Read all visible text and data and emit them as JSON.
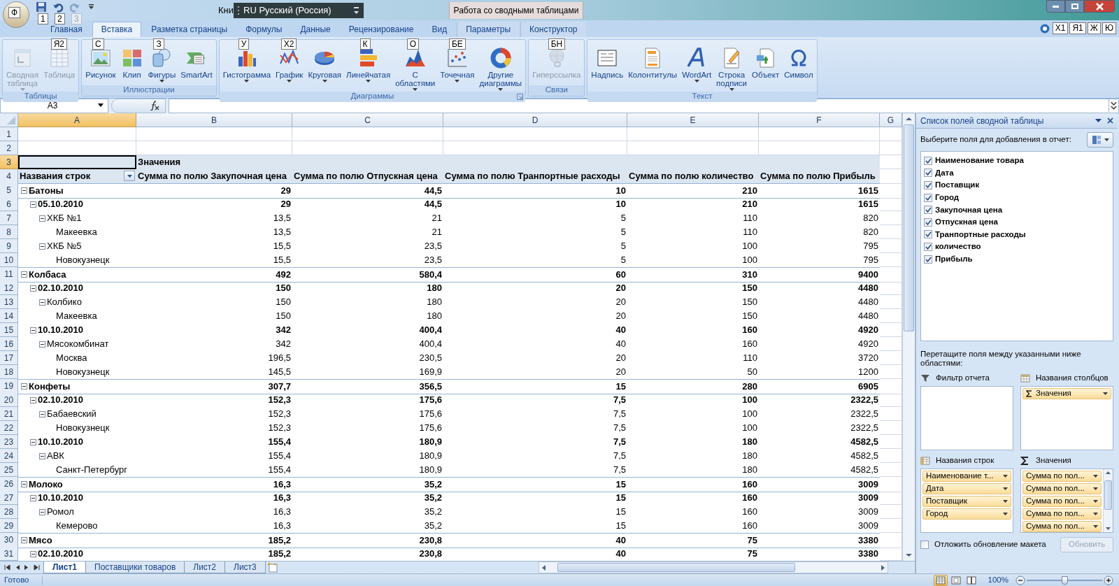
{
  "title_bar": {
    "office_keytip": "Ф",
    "quick_access": [
      {
        "keytip": "1",
        "disabled": false
      },
      {
        "keytip": "2",
        "disabled": false
      },
      {
        "keytip": "3",
        "disabled": true
      }
    ],
    "title": "Кни",
    "language_bar": "RU Русский (Россия)",
    "context_title": "Работа со сводными таблицами"
  },
  "tabs": [
    {
      "label": "Главная",
      "selected": false,
      "contextual": false
    },
    {
      "label": "Вставка",
      "selected": true,
      "contextual": false
    },
    {
      "label": "Разметка страницы",
      "selected": false,
      "contextual": false
    },
    {
      "label": "Формулы",
      "selected": false,
      "contextual": false
    },
    {
      "label": "Данные",
      "selected": false,
      "contextual": false
    },
    {
      "label": "Рецензирование",
      "selected": false,
      "contextual": false
    },
    {
      "label": "Вид",
      "selected": false,
      "contextual": false
    },
    {
      "label": "Параметры",
      "selected": false,
      "contextual": true
    },
    {
      "label": "Конструктор",
      "selected": false,
      "contextual": true
    }
  ],
  "window_keytips": [
    "Х1",
    "Я1",
    "Ж",
    "Ю"
  ],
  "ribbon_groups": [
    {
      "label": "Таблицы",
      "launcher": false,
      "buttons": [
        {
          "label": "Сводная\nтаблица",
          "disabled": true,
          "dropdown": true
        },
        {
          "label": "Таблица",
          "disabled": true,
          "dropdown": false,
          "keytip": "Я2"
        }
      ]
    },
    {
      "label": "Иллюстрации",
      "launcher": false,
      "buttons": [
        {
          "label": "Рисунок",
          "disabled": false,
          "dropdown": false,
          "keytip": "С"
        },
        {
          "label": "Клип",
          "disabled": false,
          "dropdown": false
        },
        {
          "label": "Фигуры",
          "disabled": false,
          "dropdown": true,
          "keytip": "З"
        },
        {
          "label": "SmartArt",
          "disabled": false,
          "dropdown": false
        }
      ]
    },
    {
      "label": "Диаграммы",
      "launcher": true,
      "buttons": [
        {
          "label": "Гистограмма",
          "disabled": false,
          "dropdown": true,
          "keytip": "У"
        },
        {
          "label": "График",
          "disabled": false,
          "dropdown": true,
          "keytip": "Х2"
        },
        {
          "label": "Круговая",
          "disabled": false,
          "dropdown": true
        },
        {
          "label": "Линейчатая",
          "disabled": false,
          "dropdown": true,
          "keytip": "К"
        },
        {
          "label": "С\nобластями",
          "disabled": false,
          "dropdown": true,
          "keytip": "О"
        },
        {
          "label": "Точечная",
          "disabled": false,
          "dropdown": true,
          "keytip": "БЕ"
        },
        {
          "label": "Другие\nдиаграммы",
          "disabled": false,
          "dropdown": true
        }
      ]
    },
    {
      "label": "Связи",
      "launcher": false,
      "buttons": [
        {
          "label": "Гиперссылка",
          "disabled": true,
          "dropdown": false,
          "keytip": "БН"
        }
      ]
    },
    {
      "label": "Текст",
      "launcher": false,
      "buttons": [
        {
          "label": "Надпись",
          "disabled": false,
          "dropdown": false
        },
        {
          "label": "Колонтитулы",
          "disabled": false,
          "dropdown": false
        },
        {
          "label": "WordArt",
          "disabled": false,
          "dropdown": true
        },
        {
          "label": "Строка\nподписи",
          "disabled": false,
          "dropdown": true
        },
        {
          "label": "Объект",
          "disabled": false,
          "dropdown": false
        },
        {
          "label": "Символ",
          "disabled": false,
          "dropdown": false
        }
      ]
    }
  ],
  "formula_bar": {
    "name_box": "A3"
  },
  "sheet": {
    "columns": [
      {
        "label": "A",
        "selected": true
      },
      {
        "label": "B",
        "selected": false
      },
      {
        "label": "C",
        "selected": false
      },
      {
        "label": "D",
        "selected": false
      },
      {
        "label": "E",
        "selected": false
      },
      {
        "label": "F",
        "selected": false
      },
      {
        "label": "G",
        "selected": false
      }
    ],
    "blank_rows": [
      {
        "number": "1",
        "selected": false
      },
      {
        "number": "2",
        "selected": false
      }
    ],
    "pivot": {
      "title_row": {
        "number": "3",
        "selected": true,
        "title": "Значения"
      },
      "header_row": {
        "number": "4",
        "selected": false,
        "row_label": "Названия строк",
        "headings": [
          "Сумма по полю Закупочная цена",
          "Сумма по полю Отпускная цена",
          "Сумма по полю Транпортные расходы",
          "Сумма по полю количество",
          "Сумма по полю Прибыль"
        ]
      },
      "items": [
        {
          "number": "5",
          "label": "Батоны",
          "values": [
            "29",
            "44,5",
            "10",
            "210",
            "1615"
          ],
          "expanded": true,
          "children": [
            {
              "number": "6",
              "label": "05.10.2010",
              "values": [
                "29",
                "44,5",
                "10",
                "210",
                "1615"
              ],
              "expanded": true,
              "children": [
                {
                  "number": "7",
                  "label": "ХКБ №1",
                  "values": [
                    "13,5",
                    "21",
                    "5",
                    "110",
                    "820"
                  ],
                  "expanded": true,
                  "children": [
                    {
                      "number": "8",
                      "label": "Макеевка",
                      "values": [
                        "13,5",
                        "21",
                        "5",
                        "110",
                        "820"
                      ]
                    }
                  ]
                },
                {
                  "number": "9",
                  "label": "ХКБ №5",
                  "values": [
                    "15,5",
                    "23,5",
                    "5",
                    "100",
                    "795"
                  ],
                  "expanded": true,
                  "children": [
                    {
                      "number": "10",
                      "label": "Новокузнецк",
                      "values": [
                        "15,5",
                        "23,5",
                        "5",
                        "100",
                        "795"
                      ]
                    }
                  ]
                }
              ]
            }
          ]
        },
        {
          "number": "11",
          "label": "Колбаса",
          "values": [
            "492",
            "580,4",
            "60",
            "310",
            "9400"
          ],
          "expanded": true,
          "children": [
            {
              "number": "12",
              "label": "02.10.2010",
              "values": [
                "150",
                "180",
                "20",
                "150",
                "4480"
              ],
              "expanded": true,
              "children": [
                {
                  "number": "13",
                  "label": "Колбико",
                  "values": [
                    "150",
                    "180",
                    "20",
                    "150",
                    "4480"
                  ],
                  "expanded": true,
                  "children": [
                    {
                      "number": "14",
                      "label": "Макеевка",
                      "values": [
                        "150",
                        "180",
                        "20",
                        "150",
                        "4480"
                      ]
                    }
                  ]
                }
              ]
            },
            {
              "number": "15",
              "label": "10.10.2010",
              "values": [
                "342",
                "400,4",
                "40",
                "160",
                "4920"
              ],
              "expanded": true,
              "children": [
                {
                  "number": "16",
                  "label": "Мясокомбинат",
                  "values": [
                    "342",
                    "400,4",
                    "40",
                    "160",
                    "4920"
                  ],
                  "expanded": true,
                  "children": [
                    {
                      "number": "17",
                      "label": "Москва",
                      "values": [
                        "196,5",
                        "230,5",
                        "20",
                        "110",
                        "3720"
                      ]
                    },
                    {
                      "number": "18",
                      "label": "Новокузнецк",
                      "values": [
                        "145,5",
                        "169,9",
                        "20",
                        "50",
                        "1200"
                      ]
                    }
                  ]
                }
              ]
            }
          ]
        },
        {
          "number": "19",
          "label": "Конфеты",
          "values": [
            "307,7",
            "356,5",
            "15",
            "280",
            "6905"
          ],
          "expanded": true,
          "children": [
            {
              "number": "20",
              "label": "02.10.2010",
              "values": [
                "152,3",
                "175,6",
                "7,5",
                "100",
                "2322,5"
              ],
              "expanded": true,
              "children": [
                {
                  "number": "21",
                  "label": "Бабаевский",
                  "values": [
                    "152,3",
                    "175,6",
                    "7,5",
                    "100",
                    "2322,5"
                  ],
                  "expanded": true,
                  "children": [
                    {
                      "number": "22",
                      "label": "Новокузнецк",
                      "values": [
                        "152,3",
                        "175,6",
                        "7,5",
                        "100",
                        "2322,5"
                      ]
                    }
                  ]
                }
              ]
            },
            {
              "number": "23",
              "label": "10.10.2010",
              "values": [
                "155,4",
                "180,9",
                "7,5",
                "180",
                "4582,5"
              ],
              "expanded": true,
              "children": [
                {
                  "number": "24",
                  "label": "АВК",
                  "values": [
                    "155,4",
                    "180,9",
                    "7,5",
                    "180",
                    "4582,5"
                  ],
                  "expanded": true,
                  "children": [
                    {
                      "number": "25",
                      "label": "Санкт-Петербург",
                      "values": [
                        "155,4",
                        "180,9",
                        "7,5",
                        "180",
                        "4582,5"
                      ]
                    }
                  ]
                }
              ]
            }
          ]
        },
        {
          "number": "26",
          "label": "Молоко",
          "values": [
            "16,3",
            "35,2",
            "15",
            "160",
            "3009"
          ],
          "expanded": true,
          "children": [
            {
              "number": "27",
              "label": "10.10.2010",
              "values": [
                "16,3",
                "35,2",
                "15",
                "160",
                "3009"
              ],
              "expanded": true,
              "children": [
                {
                  "number": "28",
                  "label": "Ромол",
                  "values": [
                    "16,3",
                    "35,2",
                    "15",
                    "160",
                    "3009"
                  ],
                  "expanded": true,
                  "children": [
                    {
                      "number": "29",
                      "label": "Кемерово",
                      "values": [
                        "16,3",
                        "35,2",
                        "15",
                        "160",
                        "3009"
                      ]
                    }
                  ]
                }
              ]
            }
          ]
        },
        {
          "number": "30",
          "label": "Мясо",
          "values": [
            "185,2",
            "230,8",
            "40",
            "75",
            "3380"
          ],
          "expanded": true,
          "children": [
            {
              "number": "31",
              "label": "02.10.2010",
              "values": [
                "185,2",
                "230,8",
                "40",
                "75",
                "3380"
              ],
              "expanded": true
            }
          ]
        }
      ]
    }
  },
  "sheet_tabs": [
    {
      "label": "Лист1",
      "selected": true
    },
    {
      "label": "Поставщики товаров",
      "selected": false
    },
    {
      "label": "Лист2",
      "selected": false
    },
    {
      "label": "Лист3",
      "selected": false
    }
  ],
  "pivot_panel": {
    "title": "Список полей сводной таблицы",
    "choose_label": "Выберите поля для добавления в отчет:",
    "fields": [
      {
        "label": "Наименование товара",
        "checked": true
      },
      {
        "label": "Дата",
        "checked": true
      },
      {
        "label": "Поставщик",
        "checked": true
      },
      {
        "label": "Город",
        "checked": true
      },
      {
        "label": "Закупочная цена",
        "checked": true
      },
      {
        "label": "Отпускная цена",
        "checked": true
      },
      {
        "label": "Транпортные расходы",
        "checked": true
      },
      {
        "label": "количество",
        "checked": true
      },
      {
        "label": "Прибыль",
        "checked": true
      }
    ],
    "drag_label": "Перетащите поля между указанными ниже областями:",
    "areas": [
      {
        "kind": "filter",
        "label": "Фильтр отчета"
      },
      {
        "kind": "columns",
        "label": "Названия столбцов",
        "items": [
          {
            "kind": "values",
            "label": "Значения"
          }
        ]
      },
      {
        "kind": "rows",
        "label": "Названия строк",
        "items": [
          {
            "kind": "field",
            "label": "Наименование т..."
          },
          {
            "kind": "field",
            "label": "Дата"
          },
          {
            "kind": "field",
            "label": "Поставщик"
          },
          {
            "kind": "field",
            "label": "Город"
          }
        ]
      },
      {
        "kind": "values",
        "label": "Значения",
        "items": [
          {
            "kind": "field",
            "label": "Сумма по пол..."
          },
          {
            "kind": "field",
            "label": "Сумма по пол..."
          },
          {
            "kind": "field",
            "label": "Сумма по пол..."
          },
          {
            "kind": "field",
            "label": "Сумма по пол..."
          },
          {
            "kind": "field",
            "label": "Сумма по пол..."
          }
        ]
      }
    ],
    "defer": {
      "label": "Отложить обновление макета",
      "checked": false
    },
    "update_button": {
      "label": "Обновить",
      "disabled": true
    }
  },
  "status_bar": {
    "text": "Готово",
    "views": [
      {
        "selected": true
      },
      {
        "selected": false
      },
      {
        "selected": false
      }
    ],
    "zoom": "100%",
    "zoom_slider": {
      "level": 0.5
    }
  }
}
